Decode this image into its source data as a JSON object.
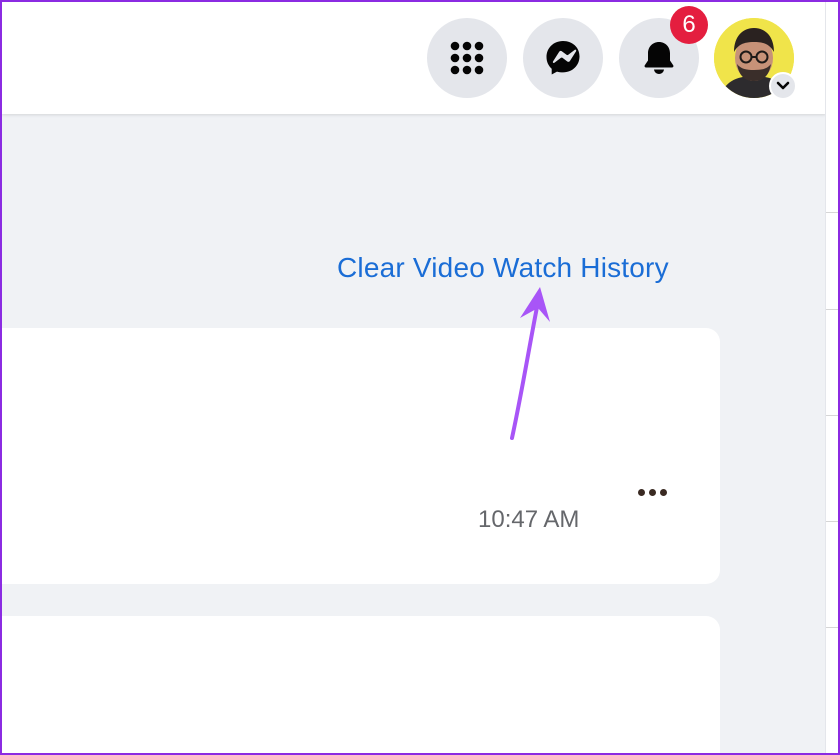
{
  "header": {
    "menu_icon": "grid-menu-icon",
    "messenger_icon": "messenger-icon",
    "notifications_icon": "bell-icon",
    "notification_count": "6",
    "avatar_chevron_icon": "chevron-down-icon"
  },
  "main": {
    "clear_history_label": "Clear Video Watch History",
    "items": [
      {
        "timestamp": "10:47 AM",
        "more_icon": "more-options-icon"
      }
    ]
  },
  "colors": {
    "accent_link": "#1a6dd6",
    "badge": "#e41e3f",
    "annotation_arrow": "#a855f7",
    "frame_border": "#8b2be2"
  }
}
